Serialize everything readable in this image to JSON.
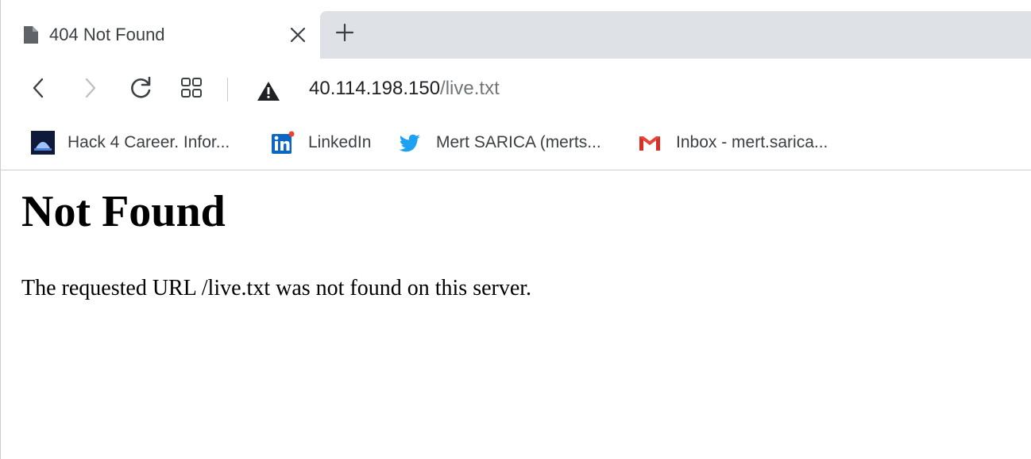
{
  "tab": {
    "title": "404 Not Found",
    "favicon": "page-icon",
    "close_icon": "close-icon",
    "new_tab_icon": "plus-icon"
  },
  "toolbar": {
    "back_icon": "back-arrow-icon",
    "forward_icon": "forward-arrow-icon",
    "reload_icon": "reload-icon",
    "apps_icon": "apps-grid-icon",
    "security_icon": "warning-triangle-icon",
    "url_host": "40.114.198.150",
    "url_path": "/live.txt"
  },
  "bookmarks": [
    {
      "label": "Hack 4 Career. Infor...",
      "icon": "hack4career-favicon"
    },
    {
      "label": "LinkedIn",
      "icon": "linkedin-icon"
    },
    {
      "label": "Mert SARICA (merts...",
      "icon": "twitter-icon"
    },
    {
      "label": "Inbox - mert.sarica...",
      "icon": "gmail-icon"
    }
  ],
  "page": {
    "heading": "Not Found",
    "message": "The requested URL /live.txt was not found on this server."
  },
  "colors": {
    "tabstrip_bg": "#dee1e6",
    "linkedin_blue": "#0a66c2",
    "twitter_blue": "#1da1f2",
    "gmail_red": "#d93025",
    "url_path_gray": "#70757a"
  }
}
